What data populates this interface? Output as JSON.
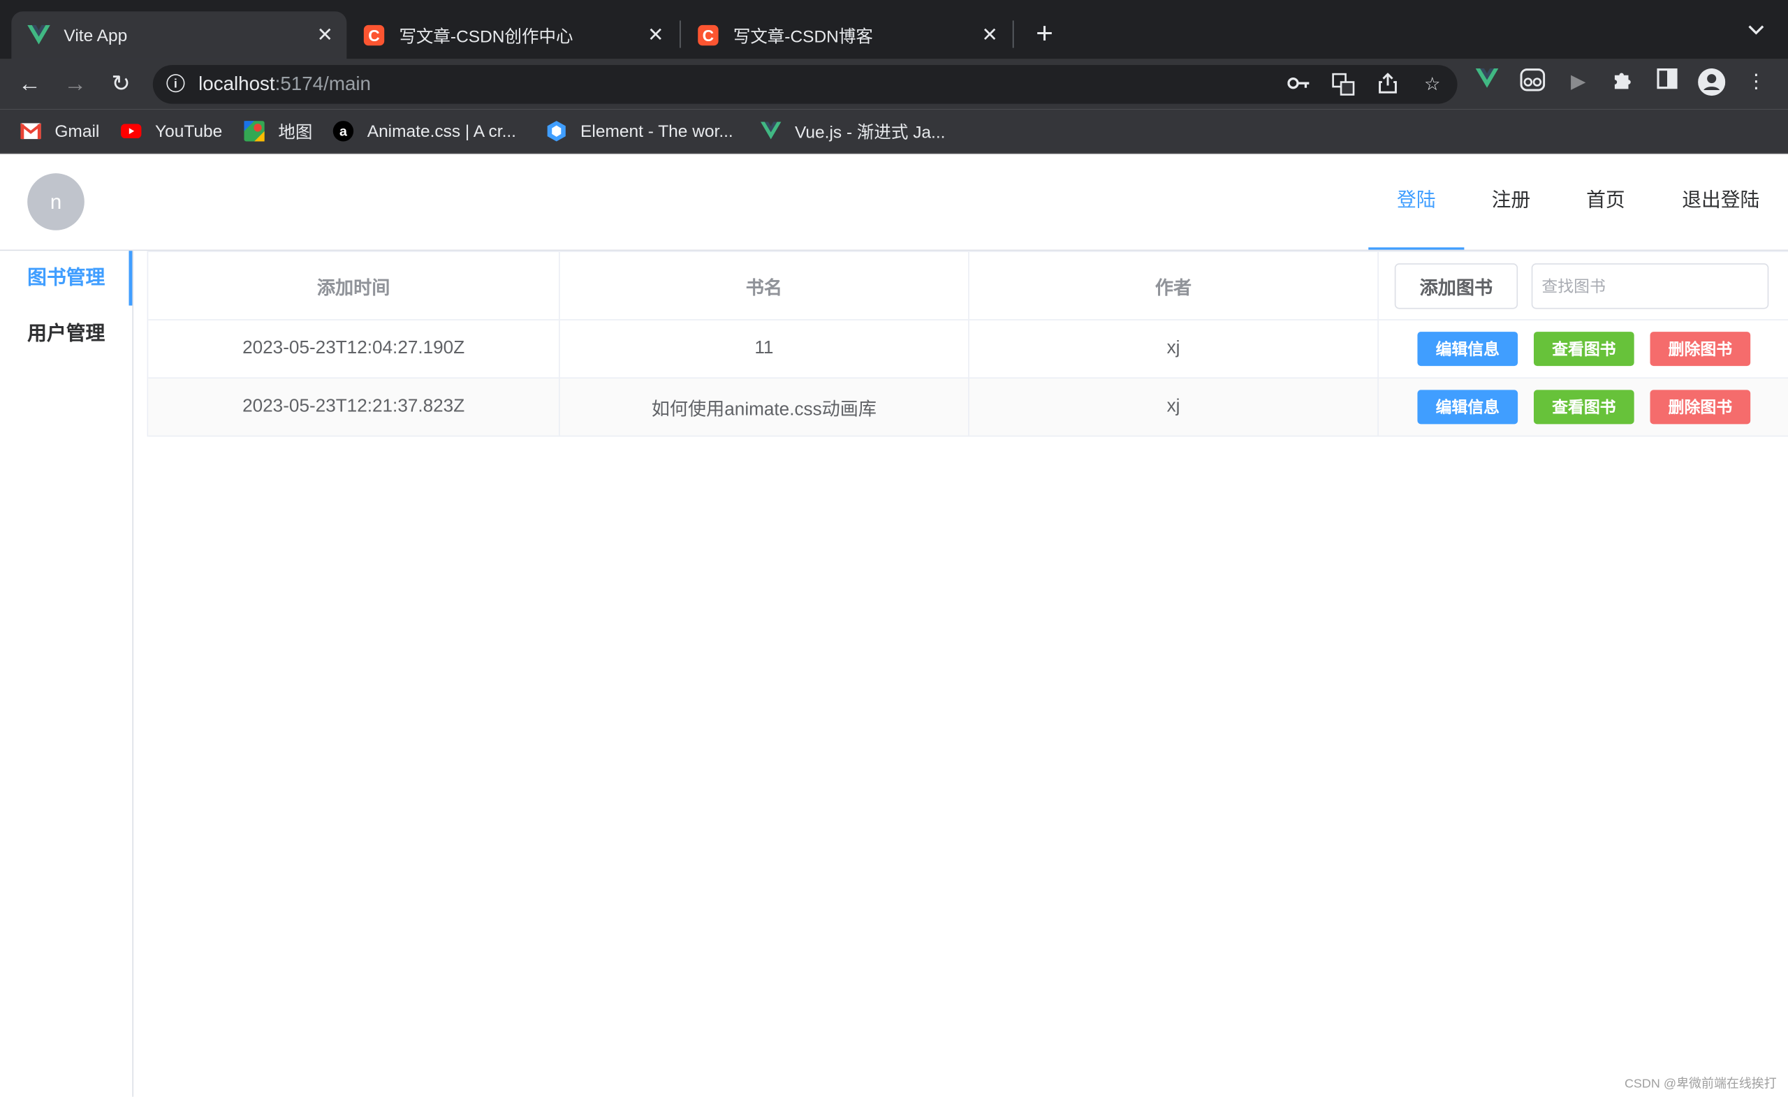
{
  "browser": {
    "tabs": [
      {
        "title": "Vite App",
        "icon": "vue-logo-icon"
      },
      {
        "title": "写文章-CSDN创作中心",
        "icon": "csdn-logo-icon"
      },
      {
        "title": "写文章-CSDN博客",
        "icon": "csdn-logo-icon"
      }
    ],
    "url": {
      "host": "localhost",
      "rest": ":5174/main"
    },
    "bookmarks": [
      {
        "label": "Gmail"
      },
      {
        "label": "YouTube"
      },
      {
        "label": "地图"
      },
      {
        "label": "Animate.css | A cr..."
      },
      {
        "label": "Element - The wor..."
      },
      {
        "label": "Vue.js - 渐进式 Ja..."
      }
    ],
    "csdn_glyph": "C",
    "animate_glyph": "a"
  },
  "app": {
    "avatar_letter": "n",
    "menu": [
      {
        "label": "登陆",
        "active": true
      },
      {
        "label": "注册"
      },
      {
        "label": "首页"
      },
      {
        "label": "退出登陆"
      }
    ],
    "sidebar": [
      {
        "label": "图书管理",
        "active": true
      },
      {
        "label": "用户管理"
      }
    ],
    "table": {
      "headers": [
        "添加时间",
        "书名",
        "作者"
      ],
      "add_button": "添加图书",
      "search_placeholder": "查找图书",
      "rows": [
        {
          "time": "2023-05-23T12:04:27.190Z",
          "name": "11",
          "author": "xj"
        },
        {
          "time": "2023-05-23T12:21:37.823Z",
          "name": "如何使用animate.css动画库",
          "author": "xj"
        }
      ],
      "actions": {
        "edit": "编辑信息",
        "view": "查看图书",
        "delete": "删除图书"
      }
    },
    "colors": {
      "primary": "#409eff",
      "success": "#67c23a",
      "danger": "#f56c6c"
    }
  },
  "watermark": "CSDN @卑微前端在线挨打"
}
